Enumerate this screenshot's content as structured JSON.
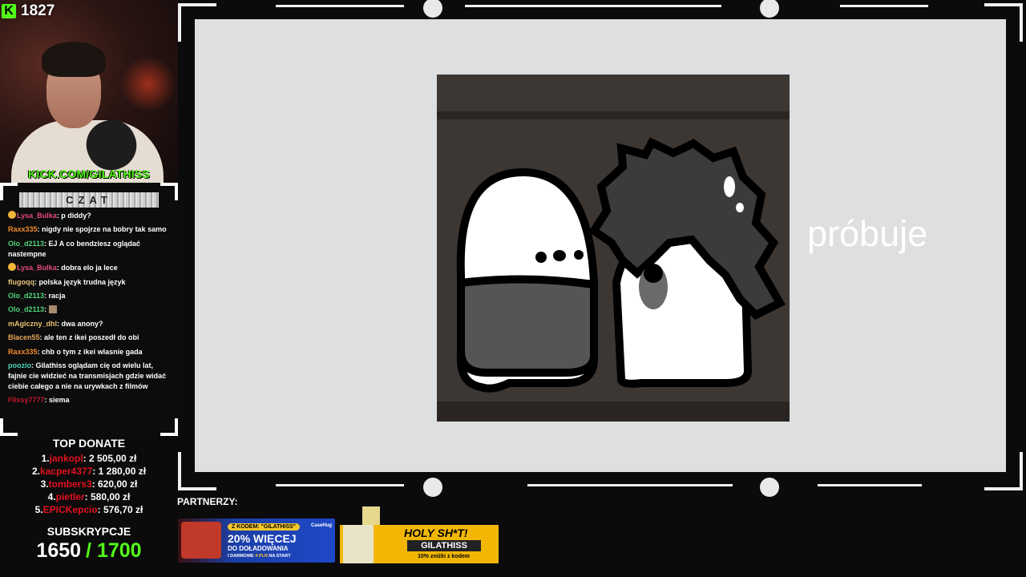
{
  "stream": {
    "viewer_count": "1827",
    "kick_logo": "K",
    "channel_url": "KICK.COM/GILATHISS",
    "caption": "próbuje"
  },
  "chat": {
    "header": "CZAT",
    "messages": [
      {
        "user": "Lysa_Bulka",
        "color": "#e3487a",
        "emoji": true,
        "text": "p diddy?"
      },
      {
        "user": "Raxx335",
        "color": "#f08a2b",
        "text": "nigdy nie spojrze na bobry tak samo"
      },
      {
        "user": "Olo_d2113",
        "color": "#4cd37a",
        "text": "EJ A co bendziesz oglądać nastempne"
      },
      {
        "user": "Lysa_Bulka",
        "color": "#e3487a",
        "emoji": true,
        "text": "dobra elo ja lece"
      },
      {
        "user": "flugoqq",
        "color": "#e7c27a",
        "text": "polska język trudna język"
      },
      {
        "user": "Olo_d2113",
        "color": "#4cd37a",
        "text": "racja"
      },
      {
        "user": "Olo_d2113",
        "color": "#4cd37a",
        "emote": true,
        "text": ""
      },
      {
        "user": "mAgiczny_dhl",
        "color": "#e6c170",
        "text": "dwa anony?"
      },
      {
        "user": "Blacen55",
        "color": "#e7a45a",
        "text": "ale ten z ikei poszedł do obi"
      },
      {
        "user": "Raxx335",
        "color": "#f08a2b",
        "text": "chb o tym z ikei wlasnie gada"
      },
      {
        "user": "poozio",
        "color": "#4ad3b2",
        "text": "Gilathiss oglądam cię od wielu lat, fajnie cie widzieć na transmisjach gdzie widać ciebie całego a nie na urywkach z filmów"
      },
      {
        "user": "Flixsy7777",
        "color": "#c2182b",
        "text": "siema"
      }
    ]
  },
  "top_donate": {
    "title": "TOP DONATE",
    "entries": [
      {
        "rank": "1.",
        "name": "jankopl",
        "amount": ": 2 505,00 zł"
      },
      {
        "rank": "2.",
        "name": "kacper4377",
        "amount": ": 1 280,00 zł"
      },
      {
        "rank": "3.",
        "name": "tombers3",
        "amount": ": 620,00 zł"
      },
      {
        "rank": "4.",
        "name": "pietler",
        "amount": ": 580,00 zł"
      },
      {
        "rank": "5.",
        "name": "EPICKepcio",
        "amount": ": 576,70 zł"
      }
    ]
  },
  "subs": {
    "title": "SUBSKRYPCJE",
    "current": "1650",
    "goal": "/ 1700"
  },
  "partners": {
    "label": "PARTNERZY:",
    "banner1": {
      "code": "Z KODEM: \"GILATHISS\"",
      "brand": "CaseHug",
      "headline": "20% WIĘCEJ",
      "sub1": "DO DOŁADOWANIA",
      "sub2_a": "I DARMOWE ",
      "sub2_b": "4 PLN",
      "sub2_c": " NA START"
    },
    "banner2": {
      "headline": "HOLY SH*T!",
      "code": "GILATHISS",
      "sub": "10% zniżki z kodem"
    }
  },
  "colors": {
    "kick_green": "#53fc18",
    "donate_red": "#e3101f",
    "stage_bg": "#dedfe1"
  }
}
